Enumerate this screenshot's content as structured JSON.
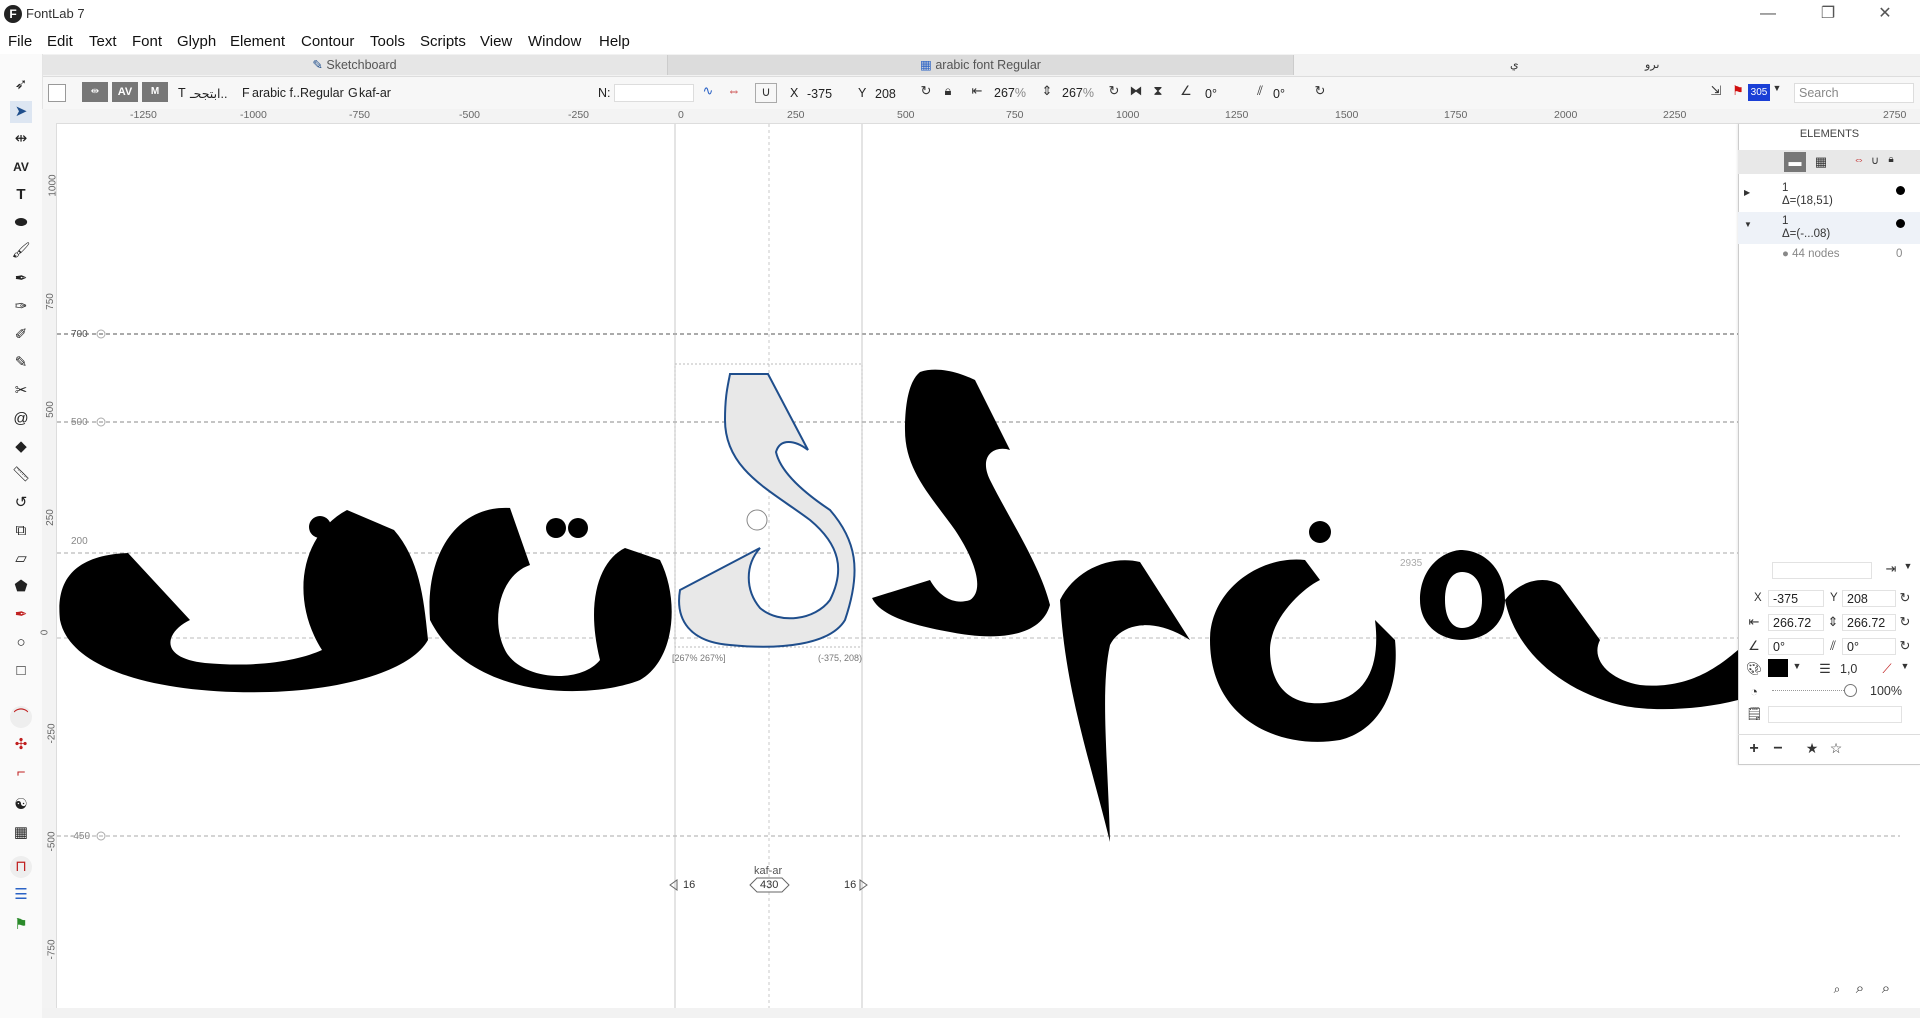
{
  "window": {
    "title": "FontLab 7",
    "logo_letter": "F",
    "minimize": "—",
    "restore": "❐",
    "close": "✕"
  },
  "menu": [
    "File",
    "Edit",
    "Text",
    "Font",
    "Glyph",
    "Element",
    "Contour",
    "Tools",
    "Scripts",
    "View",
    "Window",
    "Help"
  ],
  "tabs": {
    "sketchboard": "Sketchboard",
    "font": "arabic font Regular",
    "extra1": "ي",
    "extra2": "ىرو"
  },
  "toolbar": {
    "text_label": "T",
    "text_value": "ابتجحـ..",
    "font_label": "F",
    "font_value": "arabic f...",
    "style_value": "Regular",
    "glyph_label": "G",
    "glyph_value": "kaf-ar",
    "n_label": "N:",
    "x_label": "X",
    "x_value": "-375",
    "y_label": "Y",
    "y_value": "208",
    "w_value": "267",
    "w_unit": "%",
    "h_value": "267",
    "h_unit": "%",
    "angle_value": "0°",
    "slant_value": "0°",
    "counter": "305",
    "search_placeholder": "Search",
    "mode_av": "AV",
    "mode_m": "M"
  },
  "ruler": {
    "h_ticks": [
      "-1250",
      "-1000",
      "-750",
      "-500",
      "-250",
      "0",
      "250",
      "500",
      "750",
      "1000",
      "1250",
      "1500",
      "1750",
      "2000",
      "2250",
      "2750"
    ],
    "v_ticks": [
      "1000",
      "750",
      "500",
      "250",
      "0",
      "-250",
      "-500",
      "-750"
    ]
  },
  "metrics": {
    "ascender": "700",
    "xheight": "500",
    "caps": "200",
    "descender": "-450",
    "marker_2935": "2935"
  },
  "glyph": {
    "name": "kaf-ar",
    "advance": "430",
    "lsb": "16",
    "rsb": "16",
    "scale_label": "[267% 267%]",
    "pos_label": "(-375, 208)"
  },
  "elements": {
    "title": "ELEMENTS",
    "rows": [
      {
        "count": "1",
        "delta": "Δ=(18,51)"
      },
      {
        "count": "1",
        "delta": "Δ=(-...08)"
      }
    ],
    "nodes": "● 44 nodes",
    "nodes_count": "0",
    "x_label": "X",
    "x_value": "-375",
    "y_label": "Y",
    "y_value": "208",
    "w_value": "266.72",
    "h_value": "266.72",
    "angle_value": "0°",
    "slant_value": "0°",
    "stroke_value": "1,0",
    "opacity_value": "100%",
    "fill_color": "#000000"
  },
  "colors": {
    "accent": "#1f4e8c",
    "glyph_fill": "#000000",
    "selected_fill": "#e8e8e8",
    "counter_bg": "#1a3fd6"
  },
  "icons": [
    "pointer-icon",
    "contour-select-icon",
    "metrics-icon",
    "kerning-icon",
    "text-icon",
    "eraser-icon",
    "brush-icon",
    "pen-icon",
    "rapid-icon",
    "knife-icon",
    "shape-icon",
    "ellipse-icon",
    "rectangle-icon",
    "zoom-icon"
  ]
}
